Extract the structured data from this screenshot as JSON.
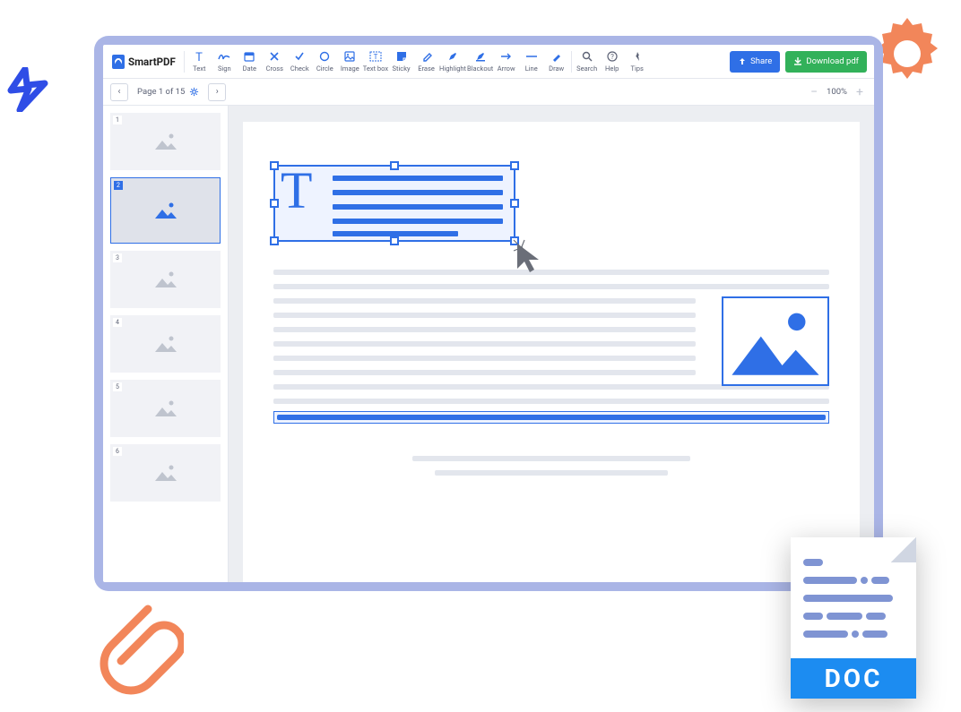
{
  "brand": {
    "name": "SmartPDF"
  },
  "toolbar": {
    "tools": [
      {
        "id": "text",
        "label": "Text"
      },
      {
        "id": "sign",
        "label": "Sign"
      },
      {
        "id": "date",
        "label": "Date"
      },
      {
        "id": "cross",
        "label": "Cross"
      },
      {
        "id": "check",
        "label": "Check"
      },
      {
        "id": "circle",
        "label": "Circle"
      },
      {
        "id": "image",
        "label": "Image"
      },
      {
        "id": "textbox",
        "label": "Text box"
      },
      {
        "id": "sticky",
        "label": "Sticky"
      },
      {
        "id": "erase",
        "label": "Erase"
      },
      {
        "id": "highlight",
        "label": "Highlight"
      },
      {
        "id": "blackout",
        "label": "Blackout"
      },
      {
        "id": "arrow",
        "label": "Arrow"
      },
      {
        "id": "line",
        "label": "Line"
      },
      {
        "id": "draw",
        "label": "Draw"
      },
      {
        "id": "search",
        "label": "Search"
      },
      {
        "id": "help",
        "label": "Help"
      },
      {
        "id": "tips",
        "label": "Tips"
      }
    ],
    "share": "Share",
    "download": "Download pdf"
  },
  "pager": {
    "label": "Page 1 of 15",
    "current": 1,
    "total": 15
  },
  "zoom": {
    "value": "100%"
  },
  "thumbnails": [
    {
      "num": "1",
      "active": false
    },
    {
      "num": "2",
      "active": true
    },
    {
      "num": "3",
      "active": false
    },
    {
      "num": "4",
      "active": false
    },
    {
      "num": "5",
      "active": false
    },
    {
      "num": "6",
      "active": false
    }
  ],
  "doc_badge": {
    "label": "DOC"
  }
}
